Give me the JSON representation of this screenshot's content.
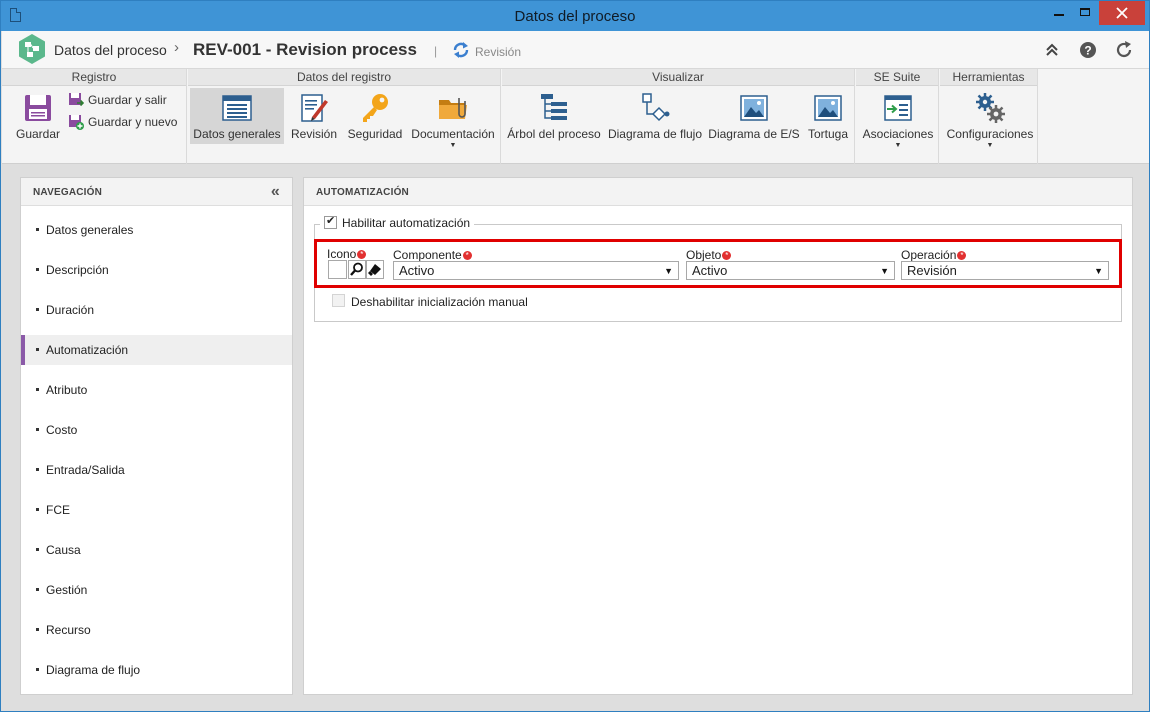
{
  "window": {
    "title": "Datos del proceso"
  },
  "header": {
    "breadcrumb_root": "Datos del proceso",
    "breadcrumb_sep": "›",
    "record_title": "REV-001 - Revision process",
    "pipe": "|",
    "status_label": "Revisión"
  },
  "ribbon": {
    "groups": {
      "registro": "Registro",
      "datos_registro": "Datos del registro",
      "visualizar": "Visualizar",
      "se_suite": "SE Suite",
      "herramientas": "Herramientas"
    },
    "guardar": "Guardar",
    "guardar_salir": "Guardar y salir",
    "guardar_nuevo": "Guardar y nuevo",
    "datos_generales": "Datos generales",
    "revision": "Revisión",
    "seguridad": "Seguridad",
    "documentacion": "Documentación",
    "arbol": "Árbol del proceso",
    "diagrama_flujo": "Diagrama de flujo",
    "diagrama_es": "Diagrama de E/S",
    "tortuga": "Tortuga",
    "asociaciones": "Asociaciones",
    "configuraciones": "Configuraciones"
  },
  "nav": {
    "title": "NAVEGACIÓN",
    "collapse_glyph": "«",
    "items": [
      "Datos generales",
      "Descripción",
      "Duración",
      "Automatización",
      "Atributo",
      "Costo",
      "Entrada/Salida",
      "FCE",
      "Causa",
      "Gestión",
      "Recurso",
      "Diagrama de flujo"
    ],
    "active_index": 3
  },
  "main": {
    "title": "AUTOMATIZACIÓN",
    "enable_automation": {
      "label": "Habilitar automatización",
      "checked": true
    },
    "icono_label": "Icono",
    "componente": {
      "label": "Componente",
      "value": "Activo"
    },
    "objeto": {
      "label": "Objeto",
      "value": "Activo"
    },
    "operacion": {
      "label": "Operación",
      "value": "Revisión"
    },
    "disable_manual": {
      "label": "Deshabilitar inicialización manual",
      "checked": false
    }
  },
  "colors": {
    "titlebar": "#3f94d6",
    "close": "#c9413a",
    "active_nav": "#8b5aa8",
    "highlight": "#e00000",
    "required": "#e23030"
  }
}
